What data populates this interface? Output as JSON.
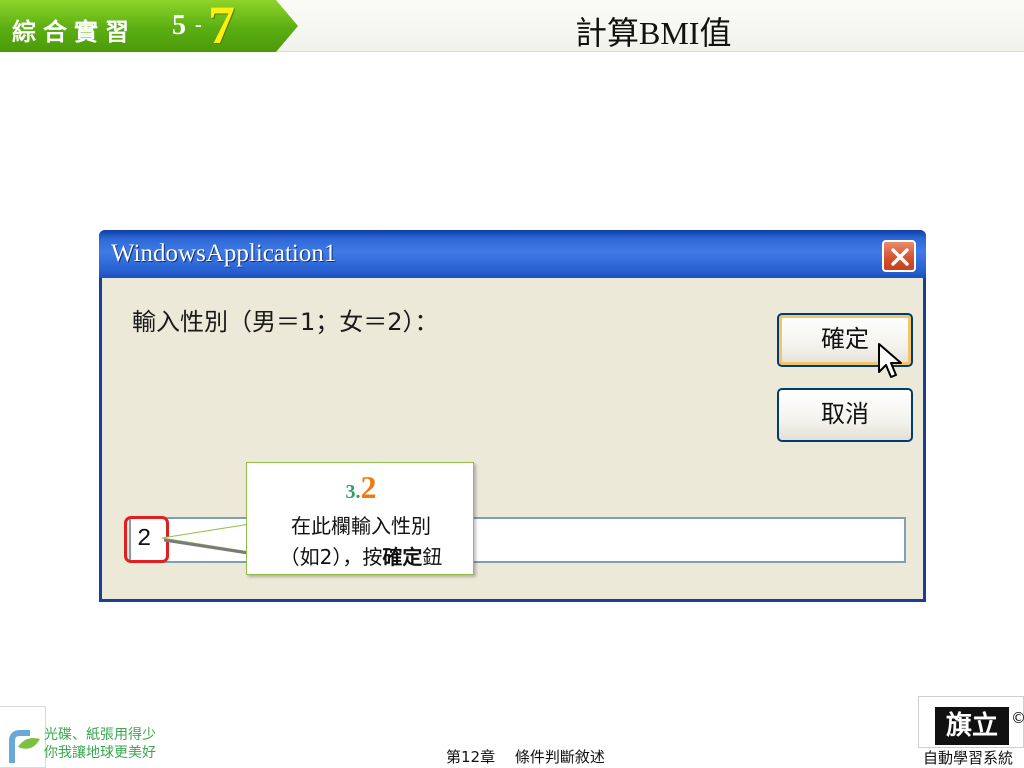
{
  "header": {
    "section_label": "綜合實習",
    "section_number": "5",
    "section_dash": "-",
    "section_sub": "7",
    "page_title": "計算BMI值"
  },
  "dialog": {
    "title": "WindowsApplication1",
    "prompt": "輸入性別（男＝1；女＝2）：",
    "ok_label": "確定",
    "cancel_label": "取消",
    "input_value": "2",
    "close_icon": "close-x-icon"
  },
  "callout": {
    "step_prefix": "3.",
    "step_number": "2",
    "line1": "在此欄輸入性別",
    "line2_prefix": "（如2），按",
    "line2_bold": "確定",
    "line2_suffix": "鈕"
  },
  "footer": {
    "eco_line1": "光碟、紙張用得少",
    "eco_line2": "你我讓地球更美好",
    "chapter": "第12章　 條件判斷敘述",
    "brand": "旗立",
    "brand_mark": "©",
    "system": "自動學習系統"
  },
  "colors": {
    "header_green": "#5aae12",
    "accent_yellow": "#ffee10",
    "titlebar_blue": "#2e68d6",
    "highlight_red": "#e02020",
    "step_orange": "#f07a12",
    "step_teal": "#2f9e6a"
  }
}
